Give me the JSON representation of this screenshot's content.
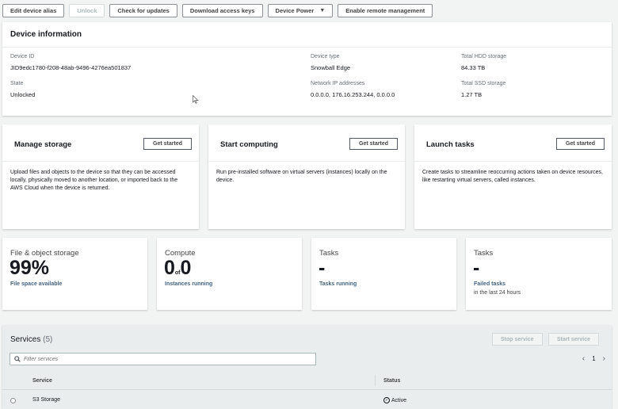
{
  "toolbar": {
    "edit_alias": "Edit device alias",
    "unlock": "Unlock",
    "check_updates": "Check for updates",
    "download_keys": "Download access keys",
    "device_power": "Device Power",
    "enable_remote": "Enable remote management"
  },
  "device_info": {
    "title": "Device information",
    "device_id_label": "Device ID",
    "device_id": "JID9edc1780-f208-48ab-9496-4276ea501837",
    "device_type_label": "Device type",
    "device_type": "Snowball Edge",
    "total_hdd_label": "Total HDD storage",
    "total_hdd": "84.33 TB",
    "state_label": "State",
    "state": "Unlocked",
    "network_label": "Network IP addresses",
    "network": "0.0.0.0, 176.16.253.244, 0.0.0.0",
    "total_ssd_label": "Total SSD storage",
    "total_ssd": "1.27 TB"
  },
  "actions": [
    {
      "title": "Manage storage",
      "button": "Get started",
      "desc": "Upload files and objects to the device so that they can be accessed locally, physically moved to another location, or imported back to the AWS Cloud when the device is returned."
    },
    {
      "title": "Start computing",
      "button": "Get started",
      "desc": "Run pre-installed software on virtual servers (instances) locally on the device."
    },
    {
      "title": "Launch tasks",
      "button": "Get started",
      "desc": "Create tasks to streamline reoccurring actions taken on device resources, like restarting virtual servers, called instances."
    }
  ],
  "metrics": [
    {
      "label": "File & object storage",
      "value": "99%",
      "link": "File space available"
    },
    {
      "label": "Compute",
      "value_a": "0",
      "of": "of",
      "value_b": "0",
      "link": "Instances running"
    },
    {
      "label": "Tasks",
      "value": "-",
      "link": "Tasks running"
    },
    {
      "label": "Tasks",
      "value": "-",
      "link": "Failed tasks",
      "sub": "in the last 24 hours"
    }
  ],
  "services": {
    "title": "Services",
    "count": "(5)",
    "stop_label": "Stop service",
    "start_label": "Start service",
    "filter_placeholder": "Filter services",
    "page": "1",
    "col_service": "Service",
    "col_status": "Status",
    "rows": [
      {
        "service": "S3 Storage",
        "status": "Active"
      }
    ]
  }
}
